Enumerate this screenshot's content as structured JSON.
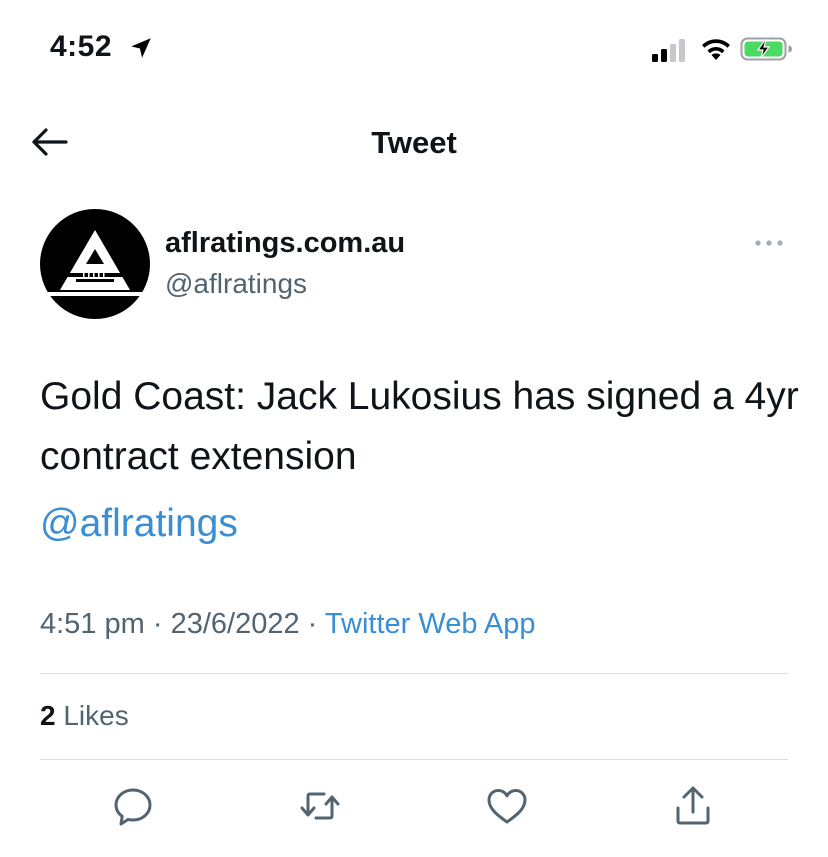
{
  "status_bar": {
    "time": "4:52",
    "icons": [
      "location-arrow-icon",
      "cellular-signal-icon",
      "wifi-icon",
      "battery-charging-icon"
    ],
    "battery_color": "#4cd964"
  },
  "header": {
    "title": "Tweet",
    "back_icon": "back-arrow-icon"
  },
  "tweet": {
    "author": {
      "display_name": "aflratings.com.au",
      "handle": "@aflratings",
      "avatar_icon": "aflratings-logo"
    },
    "more_icon": "more-dots-icon",
    "text": "Gold Coast: Jack Lukosius has signed a 4yr contract extension",
    "mention": "@aflratings",
    "meta": {
      "time": "4:51 pm",
      "separator": "·",
      "date": "23/6/2022",
      "source": "Twitter Web App"
    },
    "likes": {
      "count": "2",
      "label": "Likes"
    },
    "actions": [
      {
        "name": "reply",
        "icon": "reply-icon"
      },
      {
        "name": "retweet",
        "icon": "retweet-icon"
      },
      {
        "name": "like",
        "icon": "heart-icon"
      },
      {
        "name": "share",
        "icon": "share-icon"
      }
    ]
  },
  "colors": {
    "link": "#3a8ed3",
    "secondary_text": "#536471",
    "primary_text": "#0f1419",
    "divider": "#d9dee2"
  }
}
